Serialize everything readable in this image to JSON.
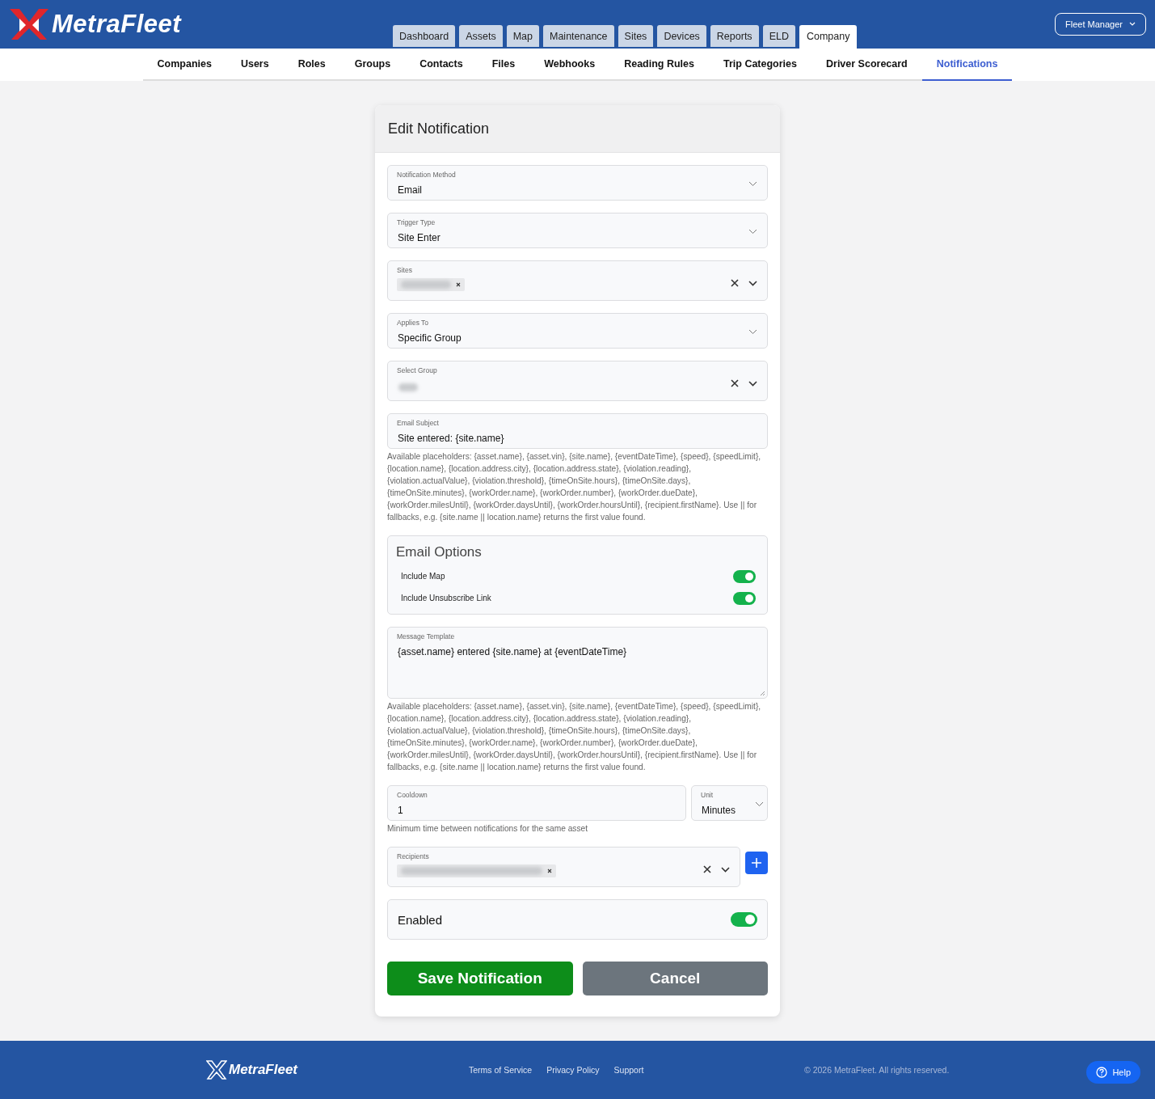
{
  "brand": "MetraFleet",
  "main_tabs": [
    {
      "label": "Dashboard",
      "selected": false
    },
    {
      "label": "Assets",
      "selected": false
    },
    {
      "label": "Map",
      "selected": false
    },
    {
      "label": "Maintenance",
      "selected": false
    },
    {
      "label": "Sites",
      "selected": false
    },
    {
      "label": "Devices",
      "selected": false
    },
    {
      "label": "Reports",
      "selected": false
    },
    {
      "label": "ELD",
      "selected": false
    },
    {
      "label": "Company",
      "selected": true
    }
  ],
  "user_menu": "Fleet Manager",
  "sub_tabs": [
    {
      "label": "Companies",
      "selected": false
    },
    {
      "label": "Users",
      "selected": false
    },
    {
      "label": "Roles",
      "selected": false
    },
    {
      "label": "Groups",
      "selected": false
    },
    {
      "label": "Contacts",
      "selected": false
    },
    {
      "label": "Files",
      "selected": false
    },
    {
      "label": "Webhooks",
      "selected": false
    },
    {
      "label": "Reading Rules",
      "selected": false
    },
    {
      "label": "Trip Categories",
      "selected": false
    },
    {
      "label": "Driver Scorecard",
      "selected": false
    },
    {
      "label": "Notifications",
      "selected": true
    }
  ],
  "form": {
    "title": "Edit Notification",
    "fields": [
      {
        "kind": "select",
        "label": "Notification Method",
        "value": "Email"
      },
      {
        "kind": "select",
        "label": "Trigger Type",
        "value": "Site Enter"
      },
      {
        "kind": "multiselect",
        "label": "Sites",
        "chips": [
          {
            "kind": "redacted"
          }
        ]
      },
      {
        "kind": "select",
        "label": "Applies To",
        "value": "Specific Group"
      },
      {
        "kind": "clearable",
        "label": "Select Group",
        "value_hidden": true
      },
      {
        "kind": "text",
        "label": "Email Subject",
        "value": "Site entered: {site.name}",
        "help": "Available placeholders: {asset.name}, {asset.vin}, {site.name}, {eventDateTime}, {speed}, {speedLimit}, {location.name}, {location.address.city}, {location.address.state}, {violation.reading}, {violation.actualValue}, {violation.threshold}, {timeOnSite.hours}, {timeOnSite.days}, {timeOnSite.minutes}, {workOrder.name}, {workOrder.number}, {workOrder.dueDate}, {workOrder.milesUntil}, {workOrder.daysUntil}, {workOrder.hoursUntil}, {recipient.firstName}. Use || for fallbacks, e.g. {site.name || location.name} returns the first value found."
      }
    ],
    "email_options": {
      "title": "Email Options",
      "toggles": [
        {
          "label": "Include Map",
          "on": true
        },
        {
          "label": "Include Unsubscribe Link",
          "on": true
        }
      ]
    },
    "message": {
      "label": "Message Template",
      "value": "{asset.name} entered {site.name} at {eventDateTime}",
      "help": "Available placeholders: {asset.name}, {asset.vin}, {site.name}, {eventDateTime}, {speed}, {speedLimit}, {location.name}, {location.address.city}, {location.address.state}, {violation.reading}, {violation.actualValue}, {violation.threshold}, {timeOnSite.hours}, {timeOnSite.days}, {timeOnSite.minutes}, {workOrder.name}, {workOrder.number}, {workOrder.dueDate}, {workOrder.milesUntil}, {workOrder.daysUntil}, {workOrder.hoursUntil}, {recipient.firstName}. Use || for fallbacks, e.g. {site.name || location.name} returns the first value found."
    },
    "cooldown": {
      "label": "Cooldown",
      "value": "1",
      "unit_label": "Unit",
      "unit": "Minutes",
      "help": "Minimum time between notifications for the same asset"
    },
    "recipients": {
      "label": "Recipients",
      "chips": [
        {
          "kind": "redacted"
        }
      ]
    },
    "enabled": {
      "label": "Enabled",
      "on": true
    },
    "buttons": [
      {
        "kind": "primary",
        "label": "Save Notification"
      },
      {
        "kind": "secondary",
        "label": "Cancel"
      }
    ]
  },
  "footer": {
    "brand": "MetraFleet",
    "links": [
      "Terms of Service",
      "Privacy Policy",
      "Support"
    ],
    "copyright": "© 2026 MetraFleet. All rights reserved.",
    "help": "Help"
  }
}
